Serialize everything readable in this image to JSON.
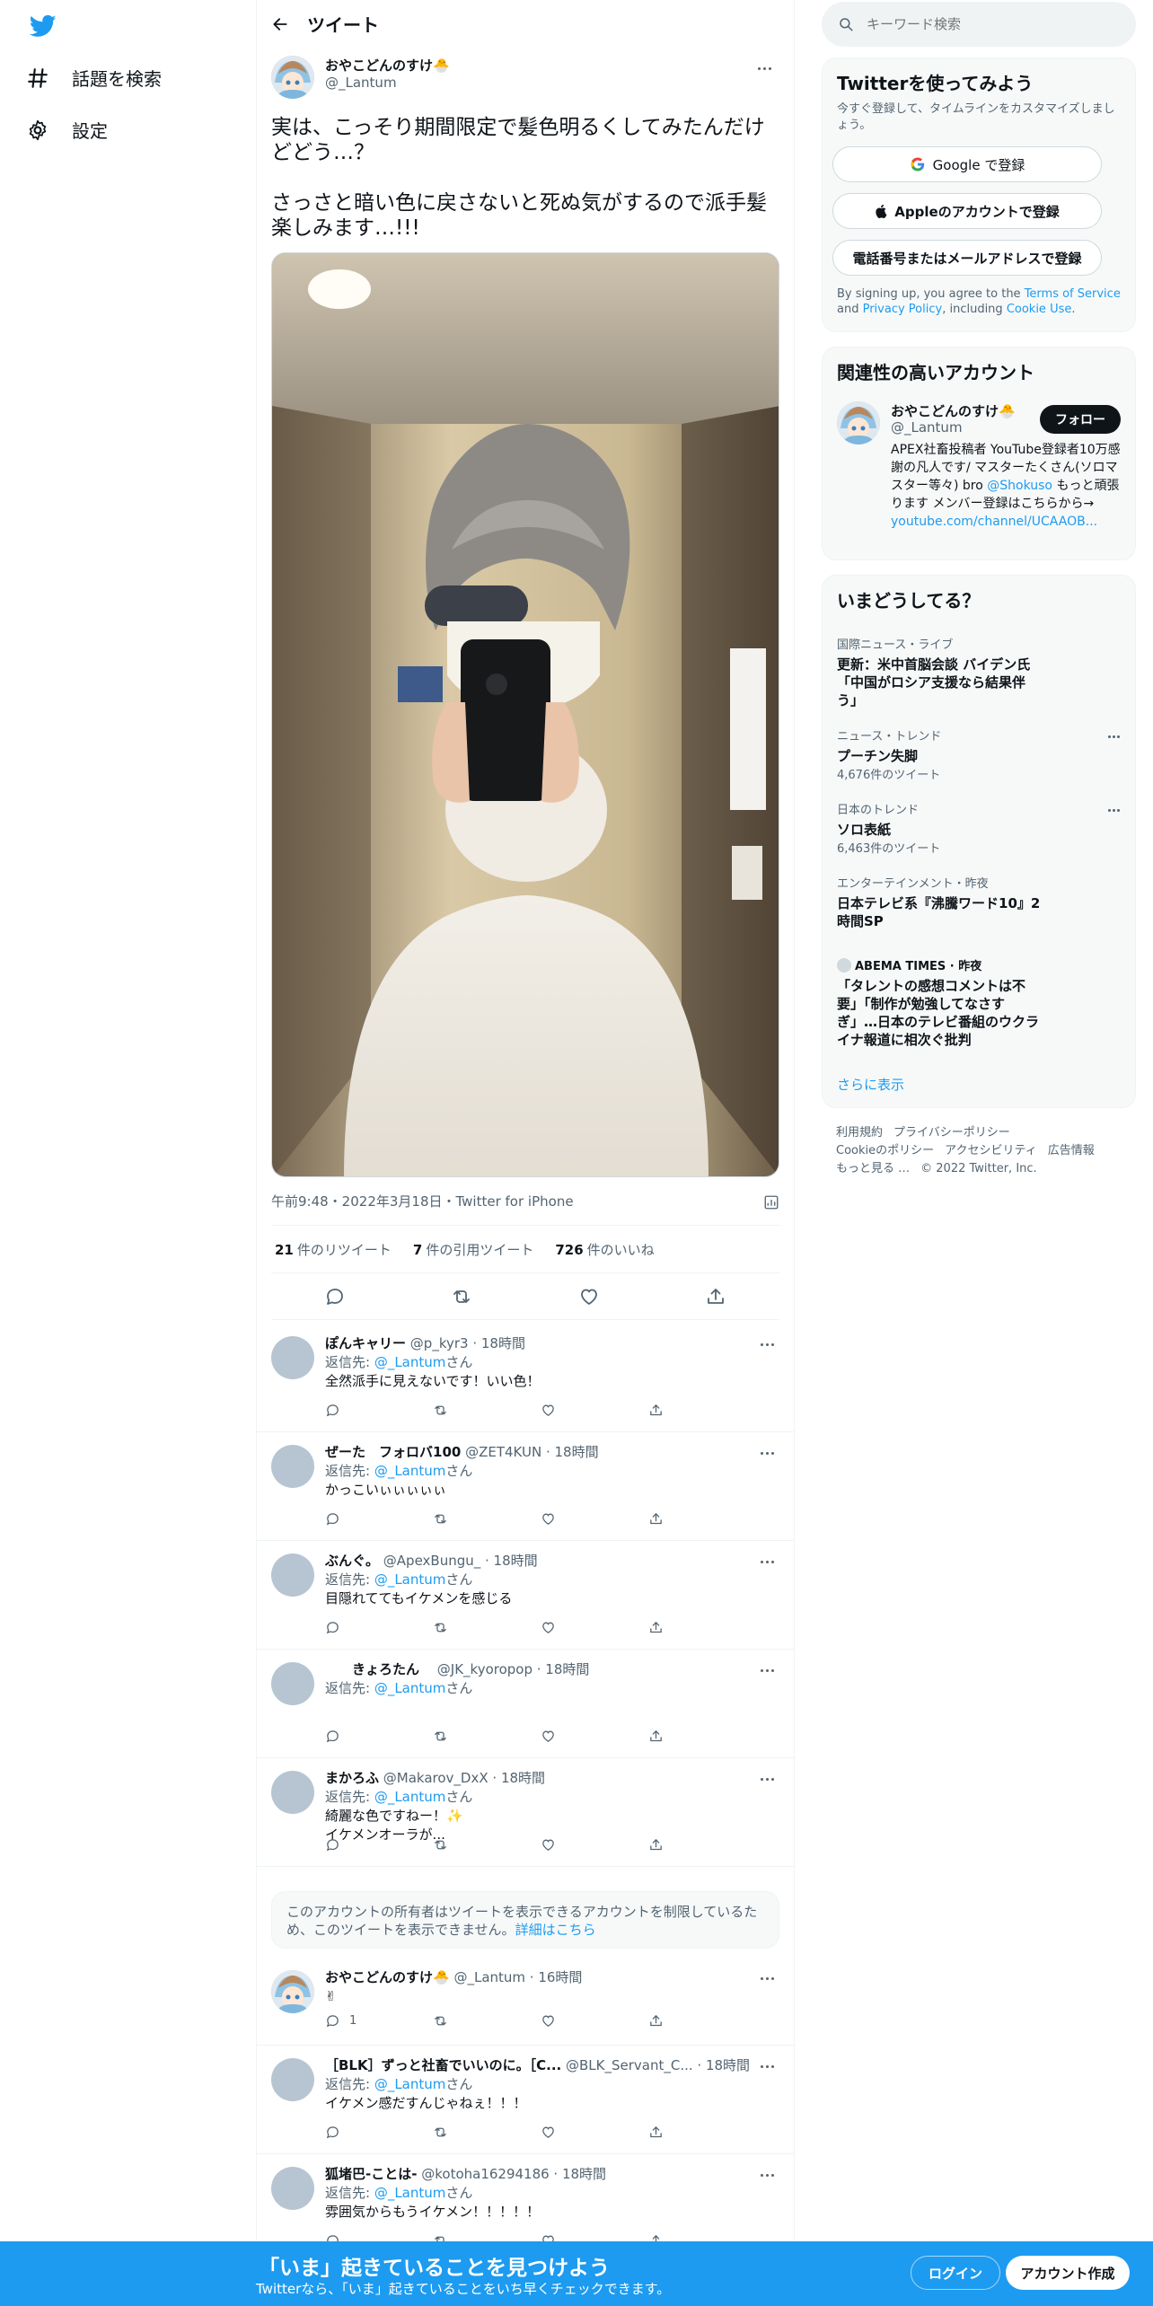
{
  "nav": {
    "explore_label": "話題を検索",
    "settings_label": "設定"
  },
  "header": {
    "title": "ツイート"
  },
  "tweet": {
    "author_name": "おやこどんのすけ🐣",
    "author_handle": "@_Lantum",
    "text": "実は、こっそり期間限定で髪色明るくしてみたんだけどどう…？\n\nさっさと暗い色に戻さないと死ぬ気がするので派手髪楽しみます…!!!",
    "meta": "午前9:48・2022年3月18日・Twitter for iPhone",
    "retweets": "21",
    "retweets_label": "件のリツイート",
    "quotes": "7",
    "quotes_label": "件の引用ツイート",
    "likes": "726",
    "likes_label": "件のいいね"
  },
  "replies": [
    {
      "name": "ぽんキャリー",
      "handle": "@p_kyr3 · 18時間",
      "to_prefix": "返信先: ",
      "to": "@_Lantum",
      "to_suffix": "さん",
      "text": "全然派手に見えないです！いい色！",
      "reply_count": ""
    },
    {
      "name": "ぜーた　フォロバ100",
      "handle": "@ZET4KUN · 18時間",
      "to_prefix": "返信先: ",
      "to": "@_Lantum",
      "to_suffix": "さん",
      "text": "かっこいぃぃぃぃぃ",
      "reply_count": ""
    },
    {
      "name": "ぶんぐ。",
      "handle": "@ApexBungu_ · 18時間",
      "to_prefix": "返信先: ",
      "to": "@_Lantum",
      "to_suffix": "さん",
      "text": "目隠れててもイケメンを感じる",
      "reply_count": ""
    },
    {
      "name": "　　きょろたん　",
      "handle": "@JK_kyoropop · 18時間",
      "to_prefix": "返信先: ",
      "to": "@_Lantum",
      "to_suffix": "さん",
      "text": "",
      "reply_count": ""
    },
    {
      "name": "まかろふ",
      "handle": "@Makarov_DxX · 18時間",
      "to_prefix": "返信先: ",
      "to": "@_Lantum",
      "to_suffix": "さん",
      "text": "綺麗な色ですねー！✨\nイケメンオーラが...",
      "reply_count": ""
    },
    {
      "name": "おやこどんのすけ🐣",
      "handle": "@_Lantum · 16時間",
      "to_prefix": "",
      "to": "",
      "to_suffix": "",
      "text": "✌",
      "reply_count": "1"
    },
    {
      "name": "［BLK］ずっと社畜でいいのに。［C...",
      "handle": "@BLK_Servant_C... · 18時間",
      "to_prefix": "返信先: ",
      "to": "@_Lantum",
      "to_suffix": "さん",
      "text": "イケメン感だすんじゃねぇ！！！",
      "reply_count": ""
    },
    {
      "name": "狐堵巴-ことは-",
      "handle": "@kotoha16294186 · 18時間",
      "to_prefix": "返信先: ",
      "to": "@_Lantum",
      "to_suffix": "さん",
      "text": "雰囲気からもうイケメン！！！！！",
      "reply_count": ""
    }
  ],
  "notice": {
    "text": "このアカウントの所有者はツイートを表示できるアカウントを制限しているため、このツイートを表示できません。",
    "link": "詳細はこちら"
  },
  "search": {
    "placeholder": "キーワード検索"
  },
  "signup": {
    "title": "Twitterを使ってみよう",
    "subtitle": "今すぐ登録して、タイムラインをカスタマイズしましょう。",
    "google": "Google で登録",
    "apple": "Appleのアカウントで登録",
    "phone": "電話番号またはメールアドレスで登録",
    "terms_1": "By signing up, you agree to the ",
    "terms_link1": "Terms of Service",
    "terms_2": " and ",
    "terms_link2": "Privacy Policy",
    "terms_3": ", including ",
    "terms_link3": "Cookie Use",
    "terms_4": "."
  },
  "related": {
    "title": "関連性の高いアカウント",
    "name": "おやこどんのすけ🐣",
    "handle": "@_Lantum",
    "follow": "フォロー",
    "bio_1": "APEX社畜投稿者 YouTube登録者10万感謝の凡人です/ マスターたくさん(ソロマスター等々) bro ",
    "bio_link": "@Shokuso",
    "bio_2": " もっと頑張ります メンバー登録はこちらから→",
    "url": "youtube.com/channel/UCAAOB..."
  },
  "trends": {
    "title": "いまどうしてる？",
    "items": [
      {
        "cat": "国際ニュース・ライブ",
        "title": "更新：米中首脳会談 バイデン氏「中国がロシア支援なら結果伴う」",
        "count": ""
      },
      {
        "cat": "ニュース・トレンド",
        "title": "プーチン失脚",
        "count": "4,676件のツイート"
      },
      {
        "cat": "日本のトレンド",
        "title": "ソロ表紙",
        "count": "6,463件のツイート"
      },
      {
        "cat": "エンターテインメント・昨夜",
        "title": "日本テレビ系『沸騰ワード10』2時間SP",
        "count": ""
      },
      {
        "cat": "ABEMA TIMES · 昨夜",
        "title": "「タレントの感想コメントは不要」「制作が勉強してなさすぎ」…日本のテレビ番組のウクライナ報道に相次ぐ批判",
        "count": ""
      }
    ],
    "more": "さらに表示"
  },
  "footer": {
    "l1": "利用規約",
    "l2": "プライバシーポリシー",
    "l3": "Cookieのポリシー",
    "l4": "アクセシビリティ",
    "l5": "広告情報",
    "l6": "もっと見る …",
    "l7": "© 2022 Twitter, Inc."
  },
  "bottom": {
    "big": "「いま」起きていることを見つけよう",
    "small": "Twitterなら、「いま」起きていることをいち早くチェックできます。",
    "login": "ログイン",
    "signup": "アカウント作成"
  },
  "colors": {
    "accent": "#1d9bf0",
    "text": "#0f1419",
    "muted": "#536471"
  }
}
